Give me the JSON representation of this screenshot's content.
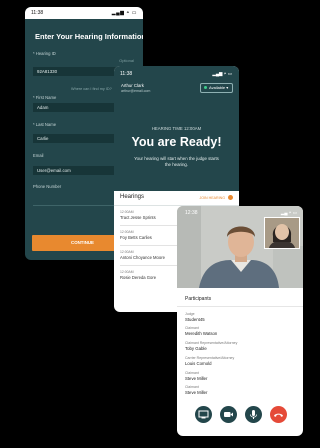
{
  "form_screen": {
    "status_time": "11:38",
    "title": "Enter Your Hearing Information",
    "fields": [
      {
        "label": "* Hearing ID",
        "value": "92A81330"
      },
      {
        "label": "* First Name",
        "value": "Adam"
      },
      {
        "label": "* Last Name",
        "value": "Carlie"
      },
      {
        "label": "Email",
        "value": "User@email.com"
      },
      {
        "label": "Phone Number",
        "value": ""
      }
    ],
    "optional_label": "Optional",
    "id_help_link": "Where can I find my ID?",
    "continue_label": "CONTINUE"
  },
  "waiting_screen": {
    "status_time": "11:38",
    "user_name": "Arthur Clark",
    "user_email": "arthur@email.com",
    "availability": "Available",
    "hearing_time": "HEARING TIME 12:00AM",
    "ready_title": "You are Ready!",
    "ready_message": "Your hearing will start when the judge starts the hearing.",
    "hearings_label": "Hearings",
    "join_label": "JOIN HEARING",
    "hearings": [
      {
        "time": "12:00AM",
        "name": "Tract Jesse Sprints"
      },
      {
        "time": "12:00AM",
        "name": "Foy Betts Carlies"
      },
      {
        "time": "12:00AM",
        "name": "Antoni Choyance Moore"
      },
      {
        "time": "12:00AM",
        "name": "Rosie Dereda Gore"
      }
    ]
  },
  "call_screen": {
    "status_time": "12:38",
    "participants_label": "Participants",
    "participants": [
      {
        "role": "Judge",
        "name": "Student45"
      },
      {
        "role": "Claimant",
        "name": "Meredith Watson"
      },
      {
        "role": "Claimant Representative/Attorney",
        "name": "Toby Gable"
      },
      {
        "role": "Carrier Representative/Attorney",
        "name": "Louis Cornold"
      },
      {
        "role": "Claimant",
        "name": "Steve Miller"
      },
      {
        "role": "Claimant",
        "name": "Steve Miller"
      }
    ],
    "accent_color": "#23464b",
    "end_call_color": "#e54a38"
  }
}
